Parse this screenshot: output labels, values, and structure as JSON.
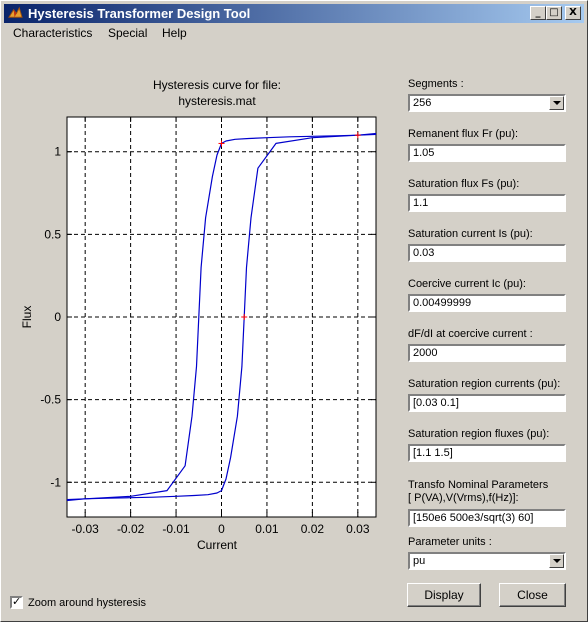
{
  "window": {
    "title": "Hysteresis Transformer Design Tool",
    "min_label": "_",
    "max_label": "□",
    "close_label": "X"
  },
  "menu": [
    {
      "label": "Characteristics"
    },
    {
      "label": "Special"
    },
    {
      "label": "Help"
    }
  ],
  "plot": {
    "title_line1": "Hysteresis curve for file:",
    "title_line2": "hysteresis.mat"
  },
  "chart_data": {
    "type": "line",
    "title": "Hysteresis curve for file: hysteresis.mat",
    "xlabel": "Current",
    "ylabel": "Flux",
    "xlim": [
      -0.034,
      0.034
    ],
    "ylim": [
      -1.21,
      1.21
    ],
    "x_ticks": [
      -0.03,
      -0.02,
      -0.01,
      0,
      0.01,
      0.02,
      0.03
    ],
    "x_tick_labels": [
      "-0.03",
      "-0.02",
      "-0.01",
      "0",
      "0.01",
      "0.02",
      "0.03"
    ],
    "y_ticks": [
      -1,
      -0.5,
      0,
      0.5,
      1
    ],
    "y_tick_labels": [
      "-1",
      "-0.5",
      "0",
      "0.5",
      "1"
    ],
    "grid": true,
    "line_color": "#0000cc",
    "marker_color": "#ff0000",
    "series": [
      {
        "x": [
          -0.034,
          -0.03,
          -0.02,
          -0.012,
          -0.008,
          -0.0065,
          -0.0055,
          -0.005,
          -0.0045,
          -0.0035,
          -0.002,
          -0.001,
          0,
          0.001,
          0.003,
          0.006,
          0.01,
          0.015,
          0.02,
          0.025,
          0.03,
          0.034
        ],
        "y": [
          -1.11,
          -1.1,
          -1.085,
          -1.05,
          -0.9,
          -0.6,
          -0.3,
          0,
          0.3,
          0.6,
          0.85,
          0.98,
          1.05,
          1.065,
          1.075,
          1.08,
          1.085,
          1.09,
          1.093,
          1.096,
          1.1,
          1.105
        ]
      },
      {
        "x": [
          0.034,
          0.03,
          0.02,
          0.012,
          0.008,
          0.0065,
          0.0055,
          0.005,
          0.0045,
          0.0035,
          0.002,
          0.001,
          0,
          -0.001,
          -0.003,
          -0.006,
          -0.01,
          -0.015,
          -0.02,
          -0.025,
          -0.03,
          -0.034
        ],
        "y": [
          1.11,
          1.1,
          1.085,
          1.05,
          0.9,
          0.6,
          0.3,
          0,
          -0.3,
          -0.6,
          -0.85,
          -0.98,
          -1.05,
          -1.065,
          -1.075,
          -1.08,
          -1.085,
          -1.09,
          -1.093,
          -1.096,
          -1.1,
          -1.105
        ]
      }
    ],
    "markers": [
      {
        "x": 0,
        "y": 1.05
      },
      {
        "x": 0.005,
        "y": 0
      },
      {
        "x": 0.03,
        "y": 1.1
      }
    ]
  },
  "params": {
    "segments_label": "Segments :",
    "segments_value": "256",
    "remanent_label": "Remanent flux Fr (pu):",
    "remanent_value": "1.05",
    "satflux_label": "Saturation flux Fs (pu):",
    "satflux_value": "1.1",
    "satcurrent_label": "Saturation current Is (pu):",
    "satcurrent_value": "0.03",
    "coercive_label": "Coercive current Ic (pu):",
    "coercive_value": "0.00499999",
    "dfdi_label": "dF/dI at coercive current :",
    "dfdi_value": "2000",
    "satregion_currents_label": "Saturation region currents (pu):",
    "satregion_currents_value": "[0.03 0.1]",
    "satregion_fluxes_label": "Saturation region fluxes (pu):",
    "satregion_fluxes_value": "[1.1 1.5]",
    "nominal_label_1": "Transfo Nominal Parameters",
    "nominal_label_2": "[ P(VA),V(Vrms),f(Hz)]:",
    "nominal_value": "[150e6  500e3/sqrt(3)  60]",
    "units_label": "Parameter units :",
    "units_value": "pu"
  },
  "buttons": {
    "display": "Display",
    "close": "Close"
  },
  "zoom": {
    "label": "Zoom around hysteresis",
    "checked": true,
    "check_glyph": "✓"
  }
}
